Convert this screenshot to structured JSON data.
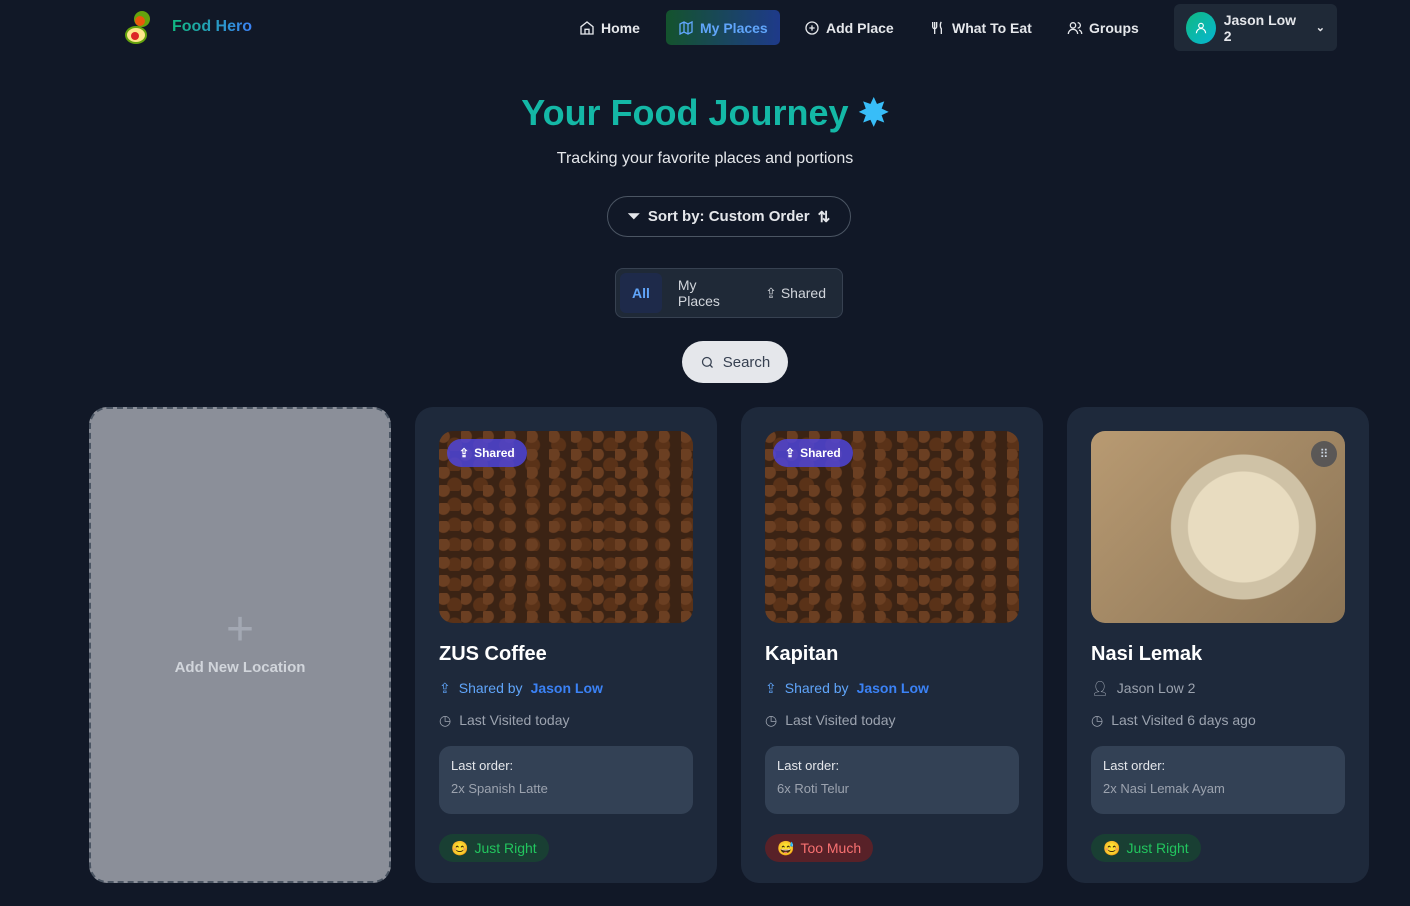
{
  "brand": {
    "name": "Food Hero"
  },
  "nav": {
    "items": [
      {
        "label": "Home",
        "icon": "home-icon"
      },
      {
        "label": "My Places",
        "icon": "map-icon",
        "active": true
      },
      {
        "label": "Add Place",
        "icon": "plus-circle-icon"
      },
      {
        "label": "What To Eat",
        "icon": "utensils-icon"
      },
      {
        "label": "Groups",
        "icon": "users-icon"
      }
    ],
    "user": "Jason Low 2"
  },
  "header": {
    "title": "Your Food Journey",
    "subtitle": "Tracking your favorite places and portions"
  },
  "sort": {
    "label": "Sort by: Custom Order"
  },
  "filters": {
    "items": [
      "All",
      "My Places",
      "Shared"
    ],
    "selected": "All"
  },
  "search": {
    "label": "Search"
  },
  "add_card": {
    "label": "Add New Location"
  },
  "cards": [
    {
      "name": "ZUS Coffee",
      "badge": "Shared",
      "shared_prefix": "Shared by",
      "owner": "Jason Low",
      "visited": "Last Visited today",
      "order_label": "Last order:",
      "order": "2x Spanish Latte",
      "portion": "Just Right",
      "emoji": "😊"
    },
    {
      "name": "Kapitan",
      "badge": "Shared",
      "shared_prefix": "Shared by",
      "owner": "Jason Low",
      "visited": "Last Visited today",
      "order_label": "Last order:",
      "order": "6x Roti Telur",
      "portion": "Too Much",
      "emoji": "😅"
    },
    {
      "name": "Nasi Lemak",
      "owner": "Jason Low 2",
      "visited": "Last Visited 6 days ago",
      "order_label": "Last order:",
      "order": "2x Nasi Lemak Ayam",
      "portion": "Just Right",
      "emoji": "😊"
    }
  ],
  "colors": {
    "background": "#111827",
    "card": "#1e293b",
    "accent": "#14b8a6",
    "link": "#60a5fa"
  }
}
